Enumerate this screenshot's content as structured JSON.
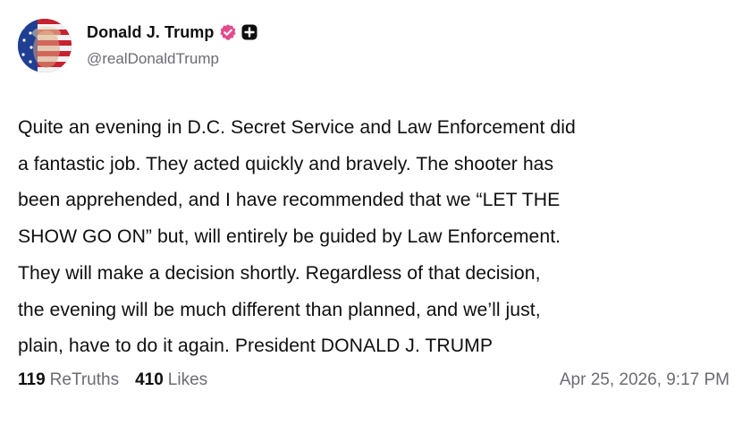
{
  "author": {
    "display_name": "Donald J. Trump",
    "handle": "@realDonaldTrump",
    "avatar_icon": "profile-avatar",
    "verified_icon": "verified-badge-icon",
    "plus_icon": "plus-badge-icon"
  },
  "post": {
    "text": "Quite an evening in D.C. Secret Service and Law Enforcement did\na fantastic job. They acted quickly and bravely. The shooter has\nbeen apprehended, and I have recommended that we “LET THE\nSHOW GO ON” but, will entirely be guided by Law Enforcement.\nThey will make a decision shortly. Regardless of that decision,\nthe evening will be much different than planned, and we’ll just,\nplain, have to do it again. President DONALD J. TRUMP"
  },
  "stats": {
    "retruths_count": "119",
    "retruths_label": "ReTruths",
    "likes_count": "410",
    "likes_label": "Likes"
  },
  "timestamp": "Apr 25, 2026, 9:17 PM",
  "colors": {
    "text_primary": "#0f0f10",
    "text_secondary": "#6b6b75",
    "verified_badge": "#e04c8c",
    "background": "#ffffff"
  }
}
